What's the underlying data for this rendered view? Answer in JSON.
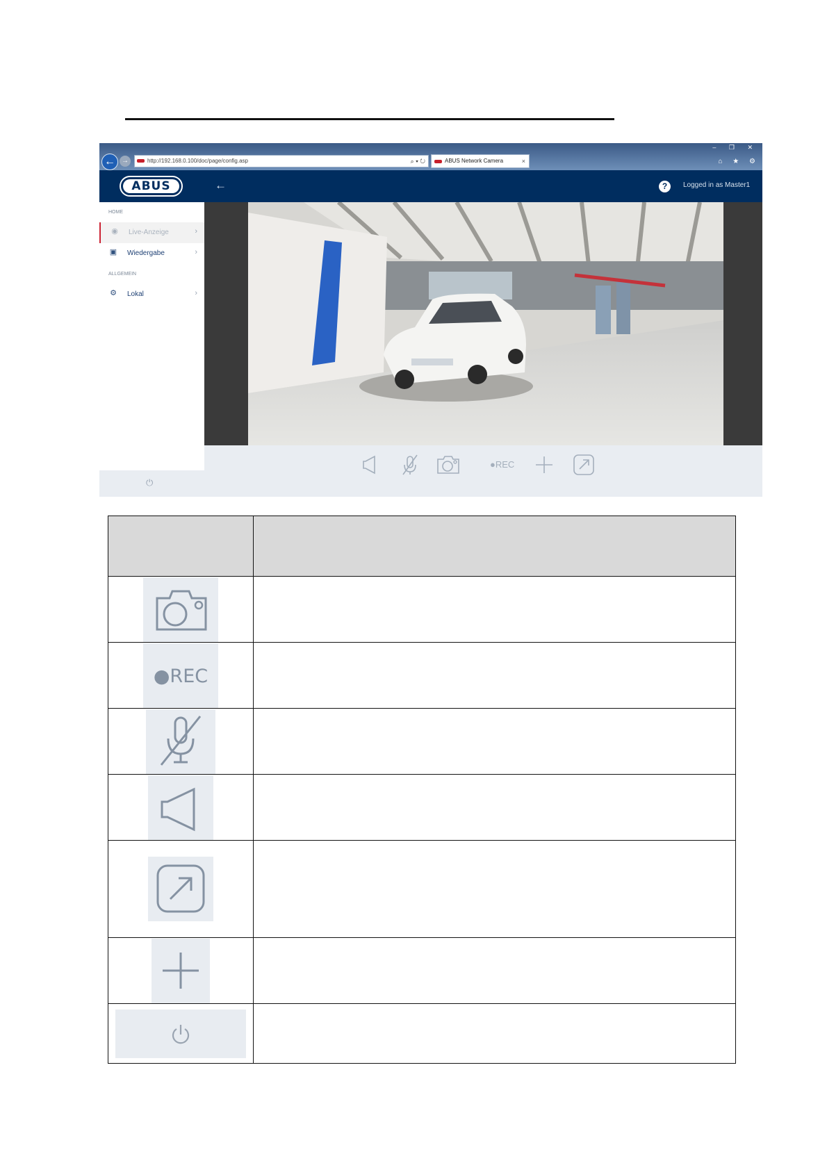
{
  "browser": {
    "url": "http://192.168.0.100/doc/page/config.asp",
    "tab_title": "ABUS Network Camera",
    "tab_close": "×",
    "window_controls": "– ❐ ✕",
    "nav_icons": "⌂ ★ ⚙"
  },
  "app": {
    "logo_text": "ABUS",
    "user_label": "Logged in as Master1",
    "help_label": "?"
  },
  "sidebar": {
    "section_home": "HOME",
    "section_general": "ALLGEMEIN",
    "items": [
      {
        "label": "Live-Anzeige",
        "active": true
      },
      {
        "label": "Wiedergabe",
        "active": false
      },
      {
        "label": "Lokal",
        "active": false
      }
    ]
  },
  "controls": {
    "rec_label": "●REC"
  },
  "legend": {
    "rec_label": "●REC",
    "rows": [
      {
        "icon": "camera-icon",
        "description": ""
      },
      {
        "icon": "rec-icon",
        "description": ""
      },
      {
        "icon": "microphone-muted-icon",
        "description": ""
      },
      {
        "icon": "speaker-icon",
        "description": ""
      },
      {
        "icon": "external-window-icon",
        "description": ""
      },
      {
        "icon": "plus-icon",
        "description": ""
      },
      {
        "icon": "power-icon",
        "description": ""
      }
    ]
  },
  "colors": {
    "app_bar": "#002d5f",
    "accent_active": "#cc2233",
    "table_header": "#d9d9d9",
    "icon_gray": "#8592a2"
  }
}
